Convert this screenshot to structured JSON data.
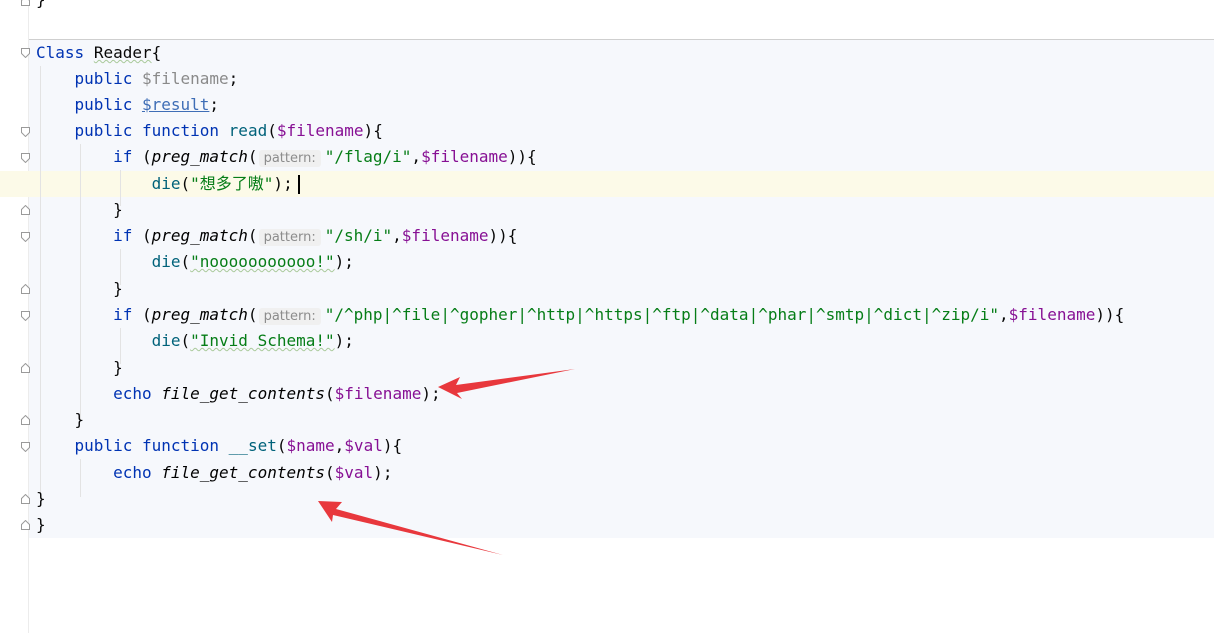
{
  "code": {
    "prev_brace": "}",
    "class_kw": "Class",
    "class_name": "Reader",
    "open_brace": "{",
    "close_brace": "}",
    "public_kw": "public",
    "function_kw": "function",
    "if_kw": "if",
    "echo_kw": "echo",
    "die_kw": "die",
    "field_filename": "$filename",
    "field_result": "$result",
    "semicolon": ";",
    "read_method": "read",
    "param_filename": "$filename",
    "preg_match": "preg_match",
    "param_hint": "pattern:",
    "flag_pattern": "\"/flag/i\"",
    "msg1": "\"想多了嗷\"",
    "sh_pattern": "\"/sh/i\"",
    "msg2": "\"nooooooooooo!\"",
    "schema_pattern": "\"/^php|^file|^gopher|^http|^https|^ftp|^data|^phar|^smtp|^dict|^zip/i\"",
    "msg3": "\"Invid Schema!\"",
    "file_get_contents": "file_get_contents",
    "set_method": "__set",
    "param_name": "$name",
    "param_val": "$val"
  },
  "colors": {
    "keyword": "#0033b3",
    "variable": "#871094",
    "string": "#067d17",
    "annotation_arrow": "#e8383d"
  }
}
